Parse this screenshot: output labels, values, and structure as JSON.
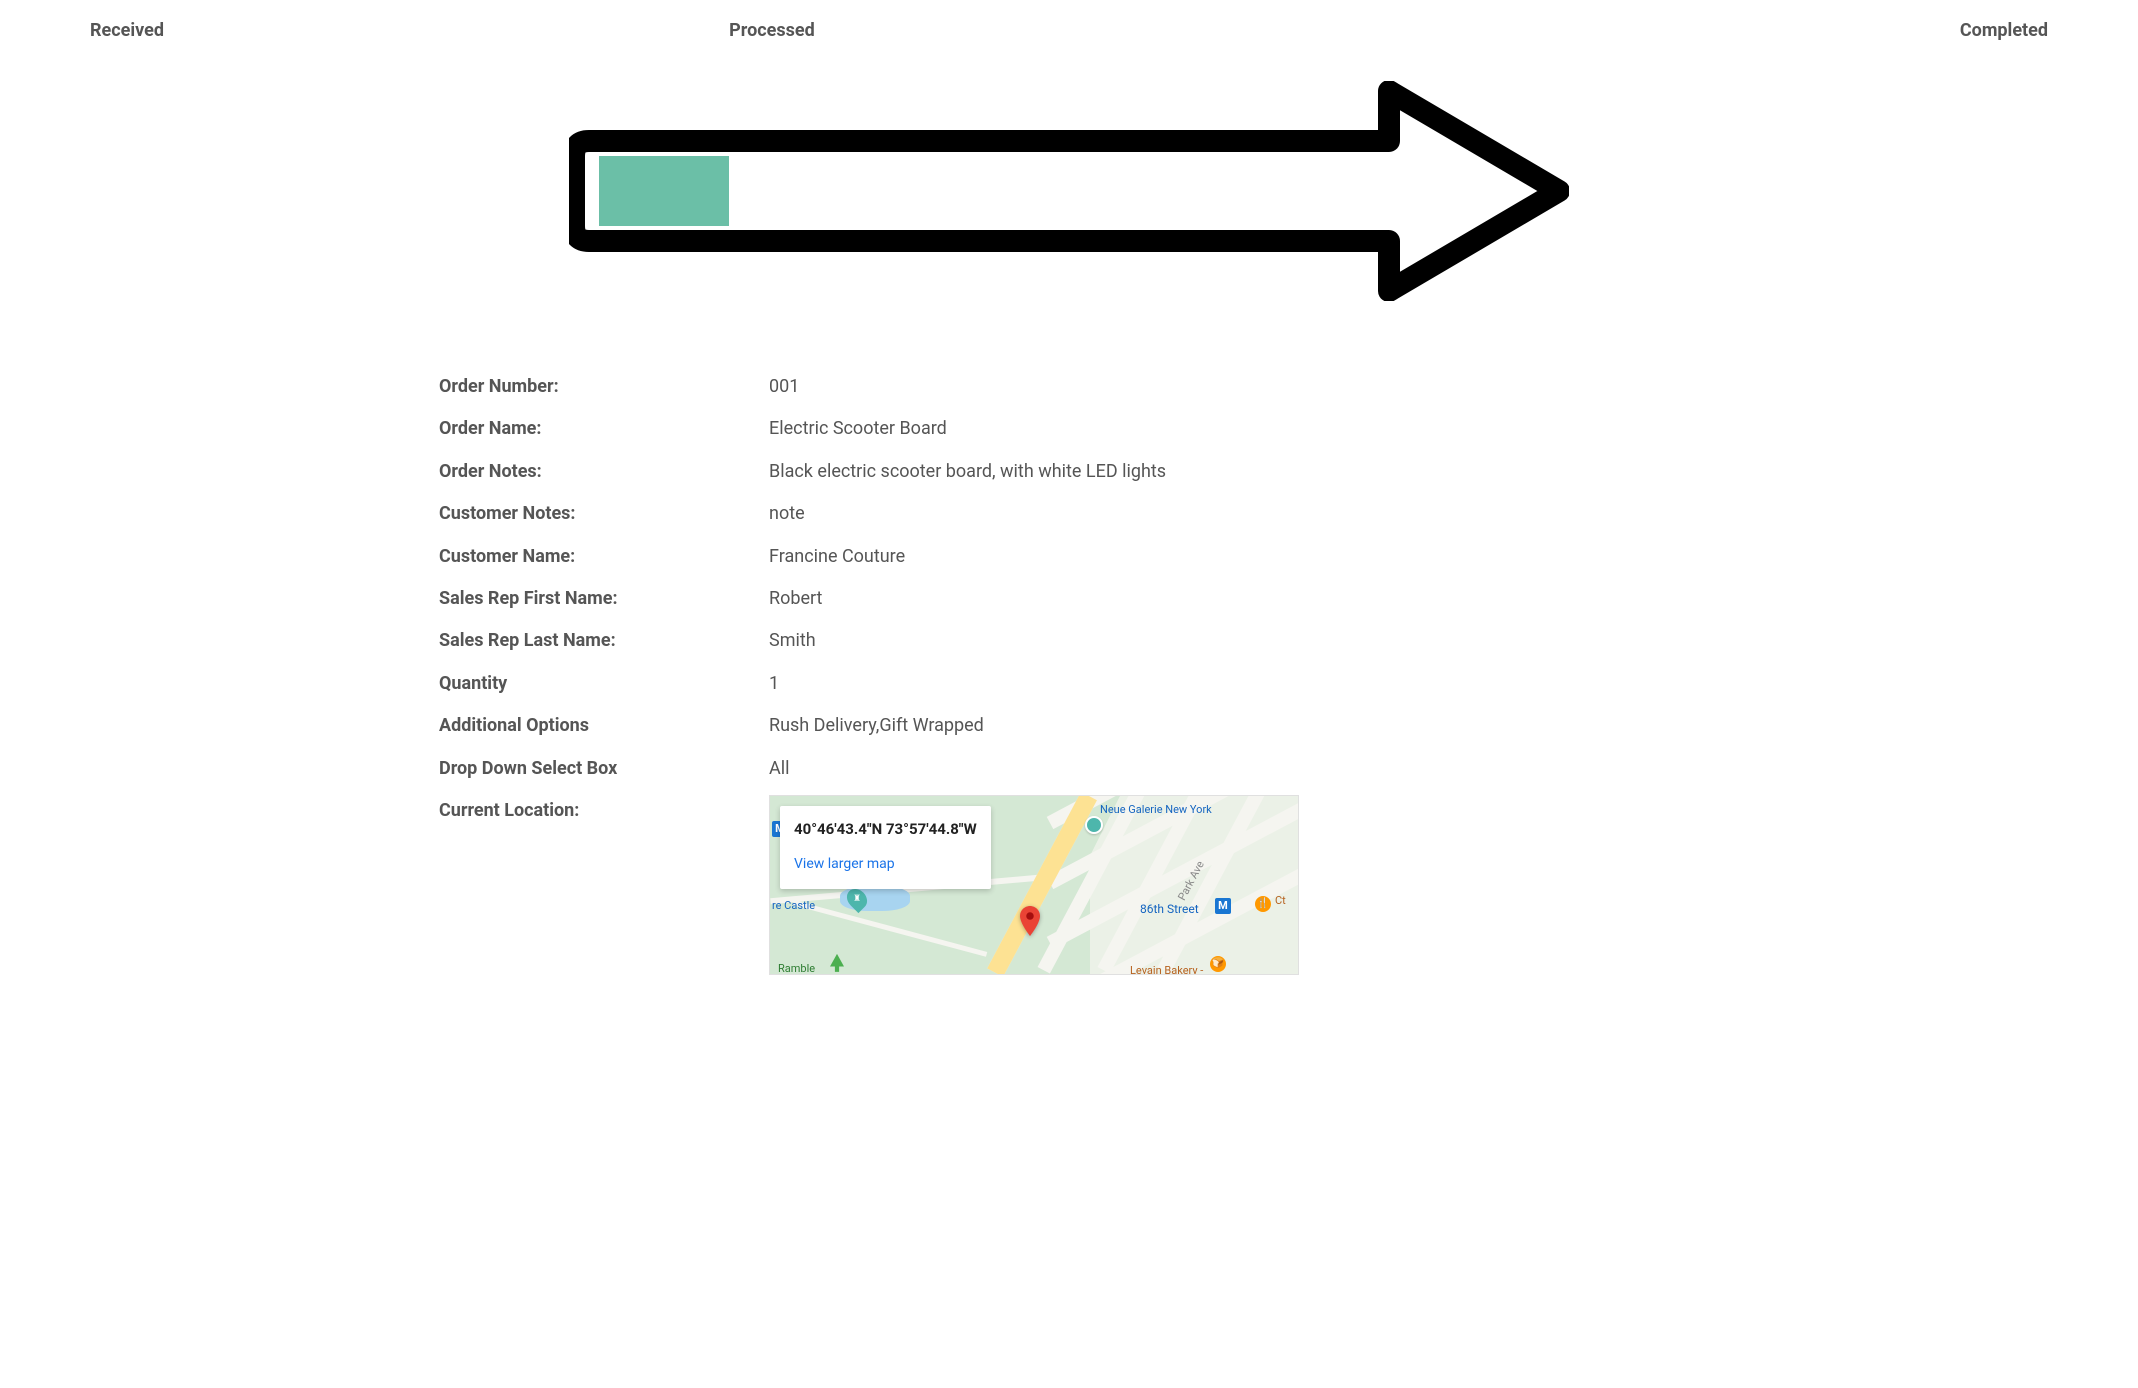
{
  "progress": {
    "received": "Received",
    "processed": "Processed",
    "completed": "Completed",
    "fill_color": "#6bbfa7"
  },
  "details": {
    "order_number_label": "Order Number:",
    "order_number_value": "001",
    "order_name_label": "Order Name:",
    "order_name_value": "Electric Scooter Board",
    "order_notes_label": "Order Notes:",
    "order_notes_value": "Black electric scooter board, with white LED lights",
    "customer_notes_label": "Customer Notes:",
    "customer_notes_value": "note",
    "customer_name_label": "Customer Name:",
    "customer_name_value": "Francine Couture",
    "sales_rep_first_label": "Sales Rep First Name:",
    "sales_rep_first_value": "Robert",
    "sales_rep_last_label": "Sales Rep Last Name:",
    "sales_rep_last_value": "Smith",
    "quantity_label": "Quantity",
    "quantity_value": "1",
    "additional_options_label": "Additional Options",
    "additional_options_value": "Rush Delivery,Gift Wrapped",
    "dropdown_label": "Drop Down Select Box",
    "dropdown_value": "All",
    "current_location_label": "Current Location:"
  },
  "map": {
    "coords": "40°46'43.4\"N 73°57'44.8\"W",
    "view_larger": "View larger map",
    "neue_galerie": "Neue Galerie New York",
    "park_ave": "Park Ave",
    "street_86": "86th Street",
    "castle": "re Castle",
    "ramble": "Ramble",
    "levain": "Levain Bakery -",
    "ct_text": "Ct",
    "m_icon": "M"
  }
}
